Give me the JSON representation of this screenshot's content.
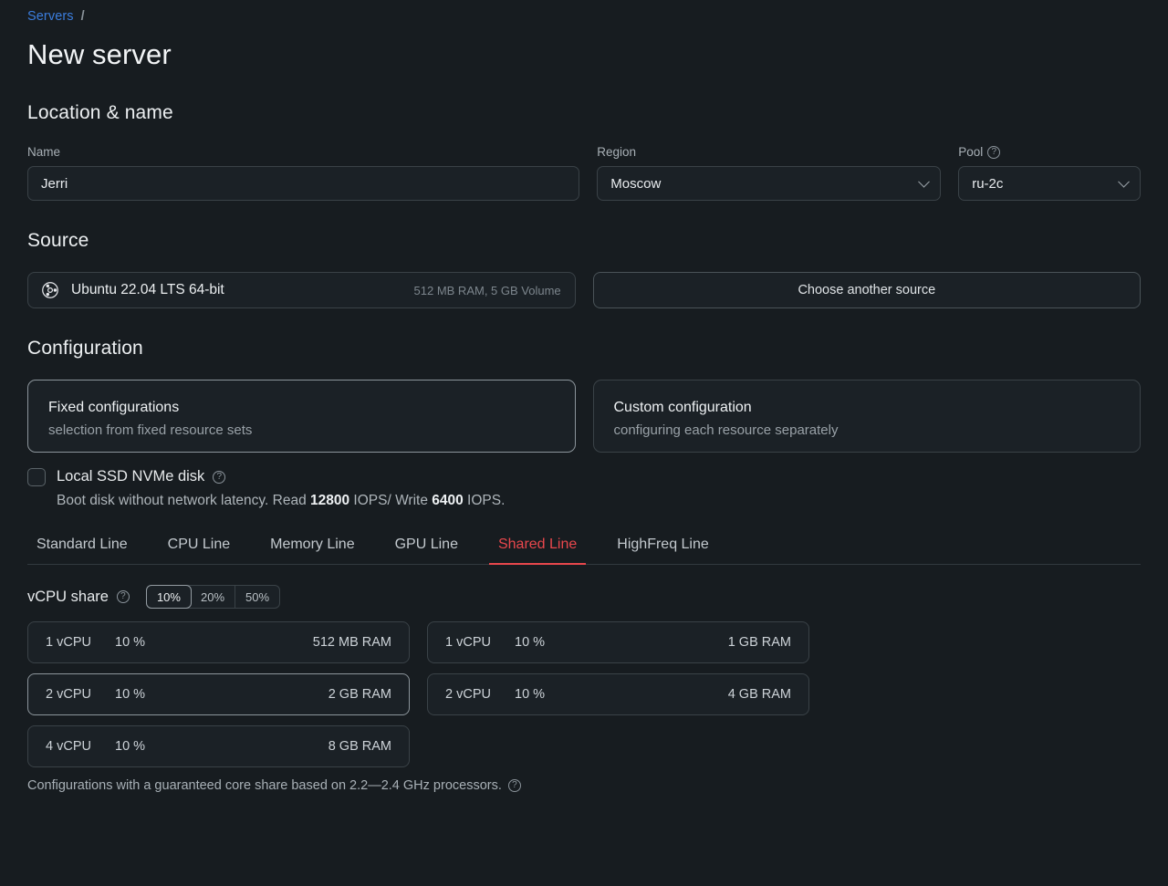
{
  "breadcrumb": {
    "root": "Servers",
    "separator": "/"
  },
  "page_title": "New server",
  "sections": {
    "location": {
      "title": "Location & name",
      "name_label": "Name",
      "name_value": "Jerri",
      "name_placeholder": "Name",
      "region_label": "Region",
      "region_value": "Moscow",
      "pool_label": "Pool",
      "pool_value": "ru-2c"
    },
    "source": {
      "title": "Source",
      "os_name": "Ubuntu 22.04 LTS 64-bit",
      "os_meta": "512 MB RAM, 5 GB Volume",
      "choose_button": "Choose another source"
    },
    "configuration": {
      "title": "Configuration",
      "options": [
        {
          "title": "Fixed configurations",
          "subtitle": "selection from fixed resource sets",
          "selected": true
        },
        {
          "title": "Custom configuration",
          "subtitle": "configuring each resource separately",
          "selected": false
        }
      ],
      "ssd": {
        "label": "Local SSD NVMe disk",
        "checked": false,
        "desc_prefix": "Boot disk without network latency. Read ",
        "desc_read_value": "12800",
        "desc_middle": " IOPS/ Write ",
        "desc_write_value": "6400",
        "desc_suffix": " IOPS."
      },
      "tabs": [
        {
          "label": "Standard Line",
          "active": false
        },
        {
          "label": "CPU Line",
          "active": false
        },
        {
          "label": "Memory Line",
          "active": false
        },
        {
          "label": "GPU Line",
          "active": false
        },
        {
          "label": "Shared Line",
          "active": true
        },
        {
          "label": "HighFreq Line",
          "active": false
        }
      ],
      "vcpu_share": {
        "label": "vCPU share",
        "options": [
          {
            "label": "10%",
            "active": true
          },
          {
            "label": "20%",
            "active": false
          },
          {
            "label": "50%",
            "active": false
          }
        ]
      },
      "plans": [
        {
          "cpu": "1 vCPU",
          "share": "10 %",
          "ram": "512 MB RAM",
          "selected": false
        },
        {
          "cpu": "1 vCPU",
          "share": "10 %",
          "ram": "1 GB RAM",
          "selected": false
        },
        {
          "cpu": "2 vCPU",
          "share": "10 %",
          "ram": "2 GB RAM",
          "selected": true
        },
        {
          "cpu": "2 vCPU",
          "share": "10 %",
          "ram": "4 GB RAM",
          "selected": false
        },
        {
          "cpu": "4 vCPU",
          "share": "10 %",
          "ram": "8 GB RAM",
          "selected": false
        }
      ],
      "footnote": "Configurations with a guaranteed core share based on 2.2—2.4 GHz processors."
    }
  },
  "icons": {
    "help": "?",
    "ubuntu": "ubuntu-logo",
    "chevron": "chevron-down"
  },
  "colors": {
    "page_bg": "#171c20",
    "accent_link": "#3b7ddd",
    "accent_active_tab": "#e8474c",
    "border": "#3a4247",
    "border_selected": "#8c959b"
  }
}
